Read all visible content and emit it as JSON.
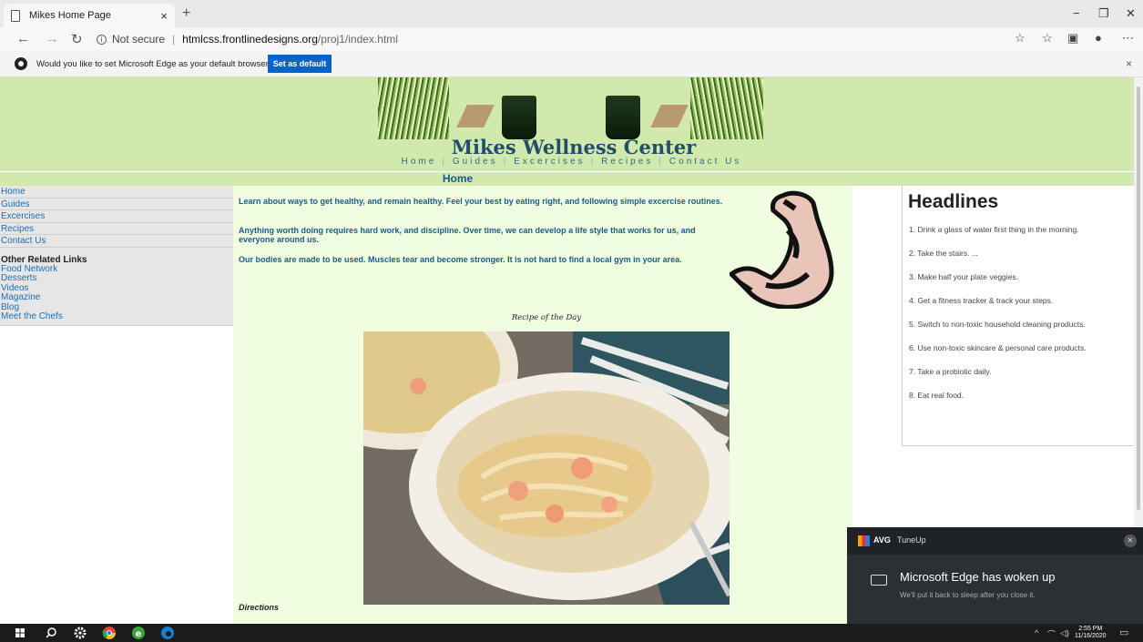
{
  "browser": {
    "tab_title": "Mikes Home Page",
    "tab_close": "×",
    "new_tab": "+",
    "window_controls": [
      "−",
      "❐",
      "✕"
    ],
    "address": {
      "security_label": "Not secure",
      "host": "htmlcss.frontlinedesigns.org",
      "path": "/proj1/index.html"
    },
    "infobar": {
      "message": "Would you like to set Microsoft Edge as your default browser?",
      "button_label": "Set as default",
      "close": "×"
    },
    "toolbar_icons": [
      "star-icon",
      "favorites-icon",
      "collections-icon",
      "profile-icon",
      "more-icon"
    ]
  },
  "site": {
    "title": "Mikes Wellness Center",
    "nav": [
      "Home",
      "Guides",
      "Excercises",
      "Recipes",
      "Contact Us"
    ],
    "page_heading": "Home",
    "sidebar": {
      "links": [
        "Home",
        "Guides",
        "Excercises",
        "Recipes",
        "Contact Us"
      ],
      "related_heading": "Other Related Links",
      "related_links": [
        "Food Network",
        "Desserts",
        "Videos",
        "Magazine",
        "Blog",
        "Meet the Chefs"
      ]
    },
    "content": {
      "paragraphs": [
        "Learn about ways to get healthy, and remain healthy. Feel your best by eating right, and following simple excercise routines.",
        "Anything worth doing requires hard work, and discipline. Over time, we can develop a life style that works for us, and everyone around us.",
        "Our bodies are made to be used. Muscles tear and become stronger. It is not hard to find a local gym in your area."
      ],
      "recipe_title": "Recipe of the Day",
      "directions_label": "Directions"
    },
    "headlines": {
      "title": "Headlines",
      "items": [
        "1. Drink a glass of water first thing in the morning.",
        "2. Take the stairs. ...",
        "3. Make half your plate veggies.",
        "4. Get a fitness tracker & track your steps.",
        "5. Switch to non-toxic household cleaning products.",
        "6. Use non-toxic skincare & personal care products.",
        "7. Take a probiotic daily.",
        "8. Eat real food."
      ]
    }
  },
  "notification": {
    "brand": "AVG",
    "app": "TuneUp",
    "title": "Microsoft Edge has woken up",
    "body": "We'll put it back to sleep after you close it."
  },
  "taskbar": {
    "time": "2:55 PM",
    "date": "11/16/2020"
  }
}
